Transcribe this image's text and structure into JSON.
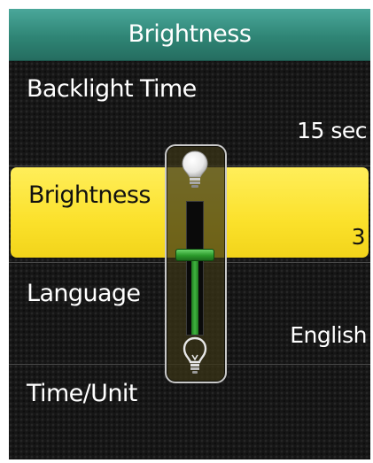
{
  "header": {
    "title": "Brightness"
  },
  "menu": {
    "items": [
      {
        "label": "Backlight Time",
        "value": "15 sec"
      },
      {
        "label": "Brightness",
        "value": "3"
      },
      {
        "label": "Language",
        "value": "English"
      },
      {
        "label": "Time/Unit",
        "value": ""
      }
    ],
    "selected_index": 1
  },
  "slider": {
    "level": 3,
    "max": 5,
    "fill_color": "#3fb33f",
    "top_icon": "bulb-on-icon",
    "bottom_icon": "bulb-off-icon"
  },
  "colors": {
    "title_bar": "#2f8575",
    "selection": "#fbe12b",
    "background": "#161616"
  }
}
